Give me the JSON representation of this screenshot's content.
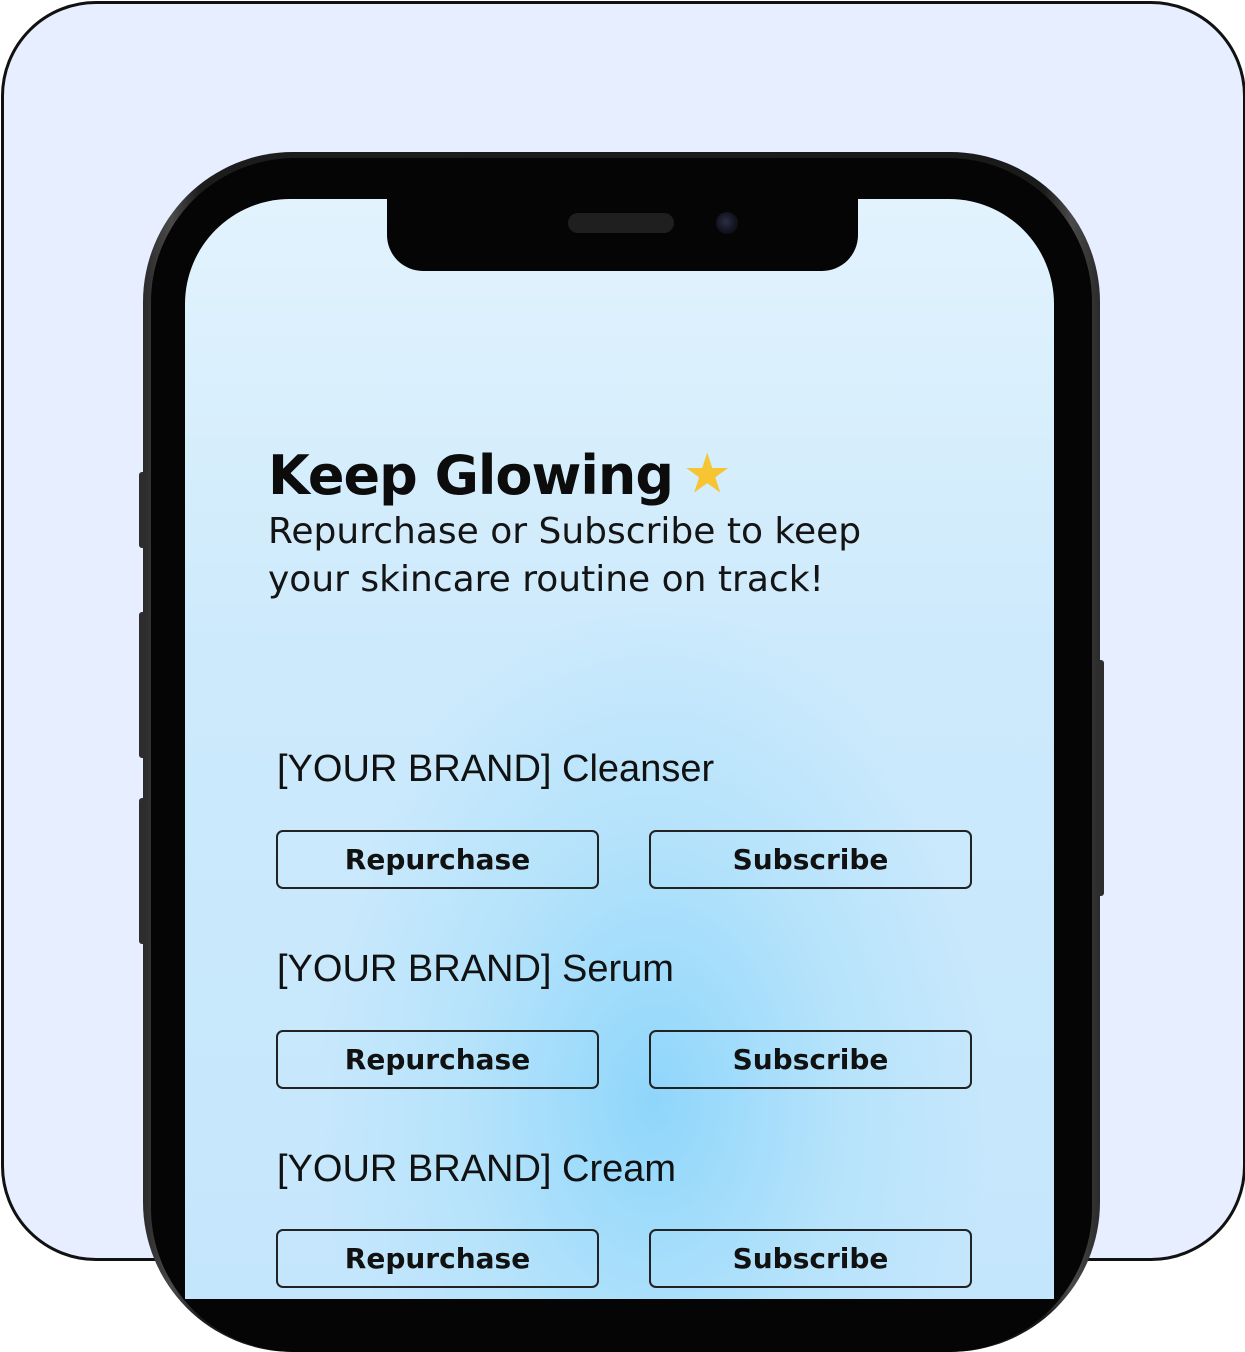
{
  "header": {
    "title": "Keep Glowing",
    "title_icon": "star-icon",
    "subtitle": "Repurchase or Subscribe to keep your skincare routine on track!"
  },
  "products": [
    {
      "name": "[YOUR BRAND] Cleanser",
      "repurchase_label": "Repurchase",
      "subscribe_label": "Subscribe"
    },
    {
      "name": "[YOUR BRAND] Serum",
      "repurchase_label": "Repurchase",
      "subscribe_label": "Subscribe"
    },
    {
      "name": "[YOUR BRAND] Cream",
      "repurchase_label": "Repurchase",
      "subscribe_label": "Subscribe"
    }
  ],
  "colors": {
    "background": "#e6eeff",
    "screen_top": "#e2f3fd",
    "screen_glow": "#8fd6fb",
    "star": "#f7c531"
  }
}
